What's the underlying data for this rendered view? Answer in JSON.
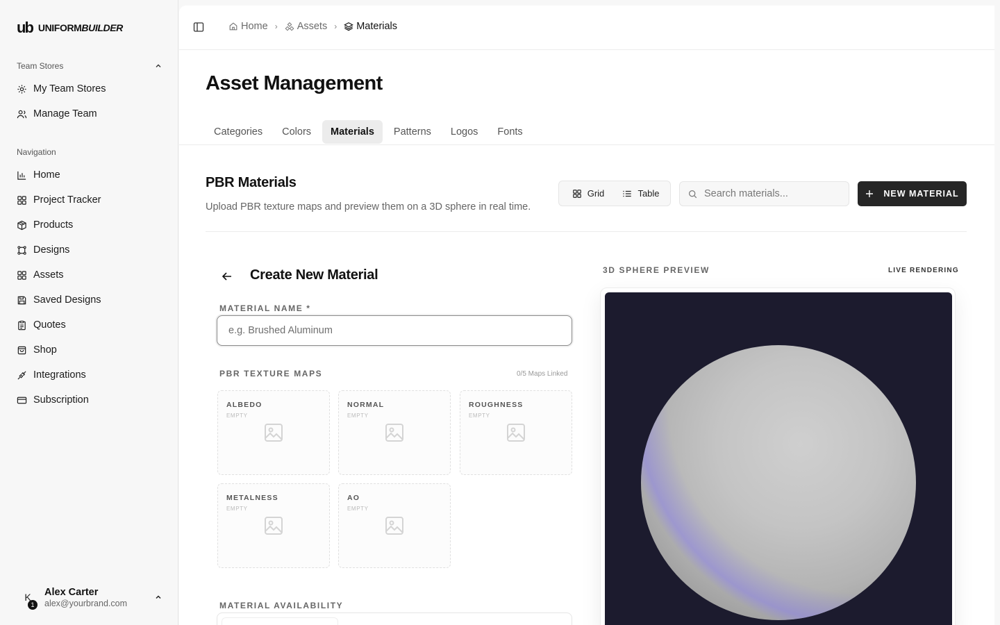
{
  "brand": {
    "mark": "ub",
    "name_regular": "UNIFORM",
    "name_italic": "BUILDER"
  },
  "sidebar": {
    "team_section": "Team Stores",
    "team_items": [
      {
        "label": "My Team Stores",
        "icon": "gear-icon"
      },
      {
        "label": "Manage Team",
        "icon": "users-icon"
      }
    ],
    "nav_section": "Navigation",
    "nav_items": [
      {
        "label": "Home",
        "icon": "bar-chart-icon"
      },
      {
        "label": "Project Tracker",
        "icon": "grid-icon"
      },
      {
        "label": "Products",
        "icon": "box-icon"
      },
      {
        "label": "Designs",
        "icon": "frame-icon"
      },
      {
        "label": "Assets",
        "icon": "grid-icon"
      },
      {
        "label": "Saved Designs",
        "icon": "save-icon"
      },
      {
        "label": "Quotes",
        "icon": "clipboard-icon"
      },
      {
        "label": "Shop",
        "icon": "shopping-bag-icon"
      },
      {
        "label": "Integrations",
        "icon": "plug-icon"
      },
      {
        "label": "Subscription",
        "icon": "credit-card-icon"
      }
    ],
    "user": {
      "initial": "K",
      "badge": "1",
      "name": "Alex Carter",
      "email": "alex@yourbrand.com"
    }
  },
  "breadcrumb": {
    "home": "Home",
    "assets": "Assets",
    "current": "Materials"
  },
  "page": {
    "title": "Asset Management",
    "tabs": [
      "Categories",
      "Colors",
      "Materials",
      "Patterns",
      "Logos",
      "Fonts"
    ],
    "active_tab": "Materials",
    "section_title": "PBR Materials",
    "section_desc": "Upload PBR texture maps and preview them on a 3D sphere in real time.",
    "view_grid": "Grid",
    "view_table": "Table",
    "search_placeholder": "Search materials...",
    "new_button": "NEW MATERIAL"
  },
  "form": {
    "title": "Create New Material",
    "name_label": "MATERIAL NAME *",
    "name_placeholder": "e.g. Brushed Aluminum",
    "maps_label": "PBR TEXTURE MAPS",
    "maps_count": "0/5 Maps Linked",
    "maps": [
      {
        "name": "ALBEDO",
        "status": "EMPTY"
      },
      {
        "name": "NORMAL",
        "status": "EMPTY"
      },
      {
        "name": "ROUGHNESS",
        "status": "EMPTY"
      },
      {
        "name": "METALNESS",
        "status": "EMPTY"
      },
      {
        "name": "AO",
        "status": "EMPTY"
      }
    ],
    "availability_label": "MATERIAL AVAILABILITY"
  },
  "preview": {
    "label": "3D SPHERE PREVIEW",
    "live": "LIVE RENDERING",
    "background_color": "#1c1b2e"
  }
}
